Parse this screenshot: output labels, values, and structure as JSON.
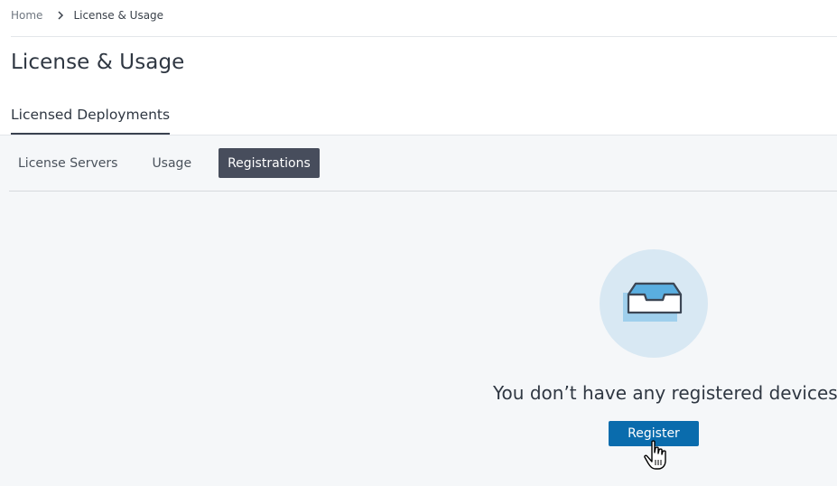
{
  "breadcrumb": {
    "home": "Home",
    "current": "License & Usage"
  },
  "page": {
    "title": "License & Usage"
  },
  "section_tab": {
    "label": "Licensed Deployments"
  },
  "subtabs": [
    {
      "label": "License Servers",
      "active": false
    },
    {
      "label": "Usage",
      "active": false
    },
    {
      "label": "Registrations",
      "active": true
    }
  ],
  "empty_state": {
    "icon": "inbox-tray-icon",
    "message": "You don’t have any registered devices",
    "button_label": "Register"
  },
  "colors": {
    "active_tab_bg": "#474d5c",
    "primary_button": "#0a6cad",
    "icon_circle": "#d8e8f3",
    "content_bg": "#f5f7f9"
  }
}
